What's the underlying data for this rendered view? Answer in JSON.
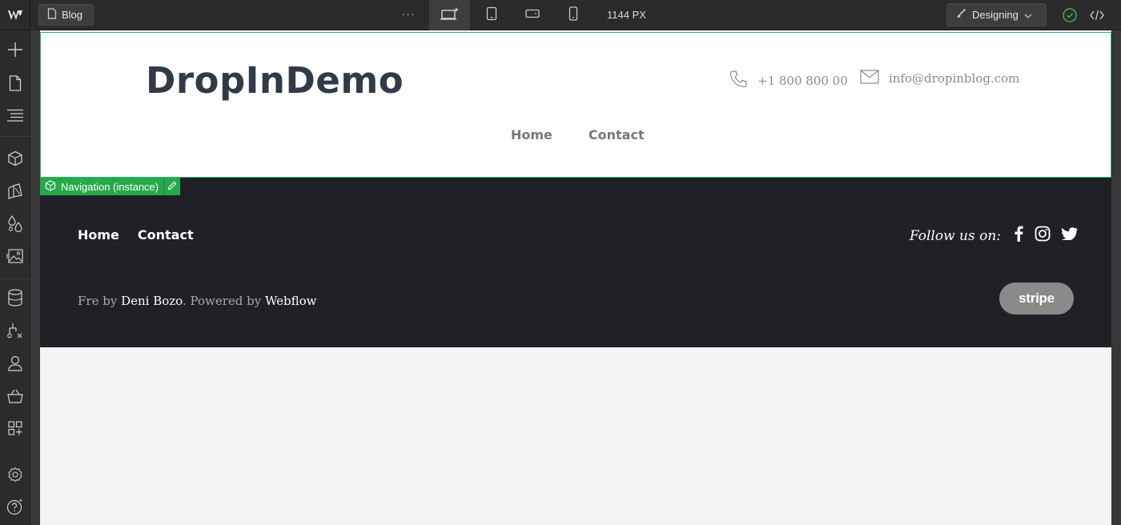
{
  "topbar": {
    "page_name": "Blog",
    "more_label": "···",
    "width_readout": "1144 PX",
    "mode_label": "Designing"
  },
  "site": {
    "brand": "DropInDemo",
    "phone": "+1 800 800 00",
    "email": "info@dropinblog.com",
    "nav": [
      "Home",
      "Contact"
    ]
  },
  "selection": {
    "label": "Navigation (instance)"
  },
  "footer": {
    "nav": [
      "Home",
      "Contact"
    ],
    "follow_label": "Follow us on:",
    "credits_prefix": "Fre by ",
    "credits_author": "Deni Bozo",
    "credits_mid": ". Powered by ",
    "credits_platform": "Webflow",
    "stripe_badge": "stripe"
  },
  "colors": {
    "selection_green": "#25a94b",
    "brand_text": "#2f3b49",
    "footer_bg": "#1f2126"
  }
}
